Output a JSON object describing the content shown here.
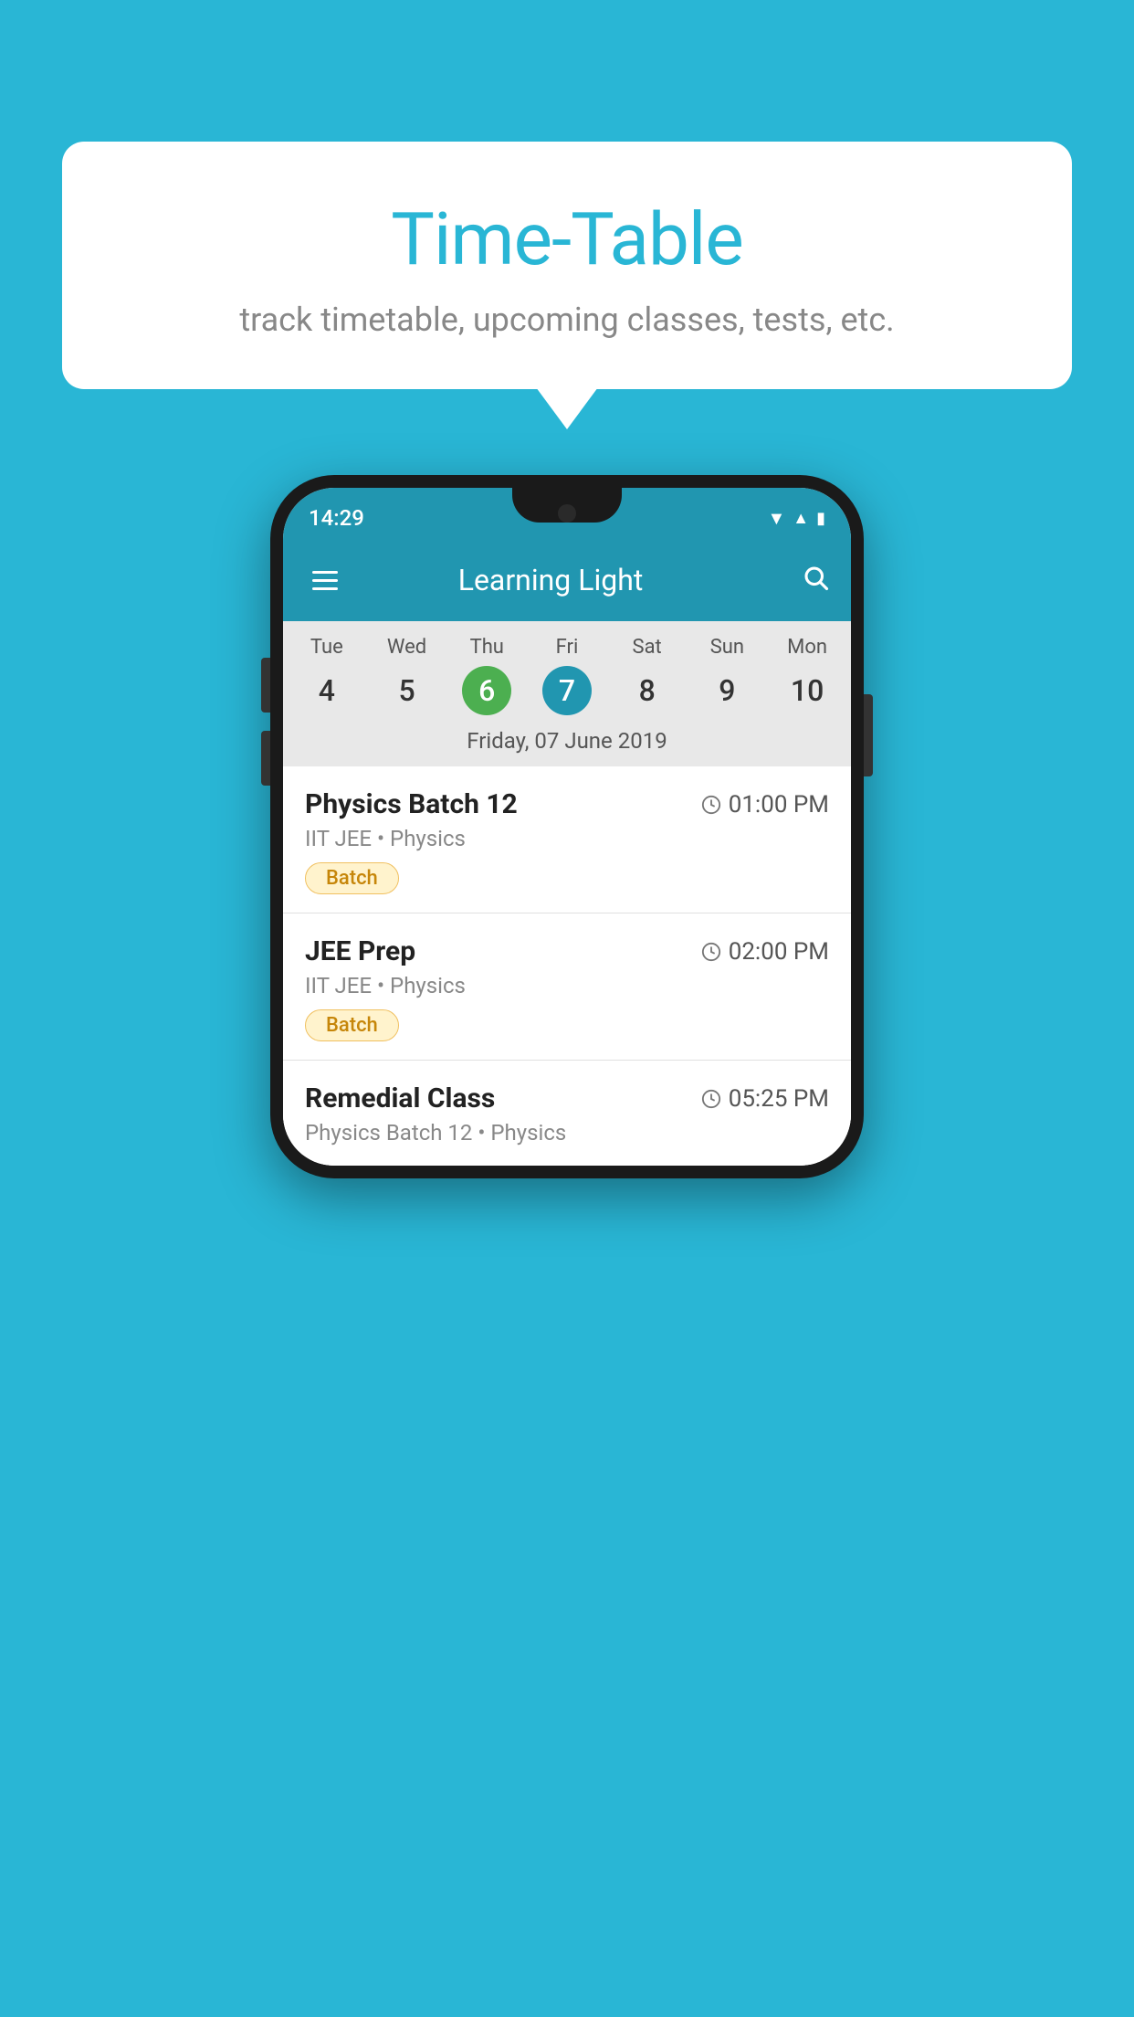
{
  "page": {
    "background_color": "#29B6D5"
  },
  "speech_bubble": {
    "title": "Time-Table",
    "subtitle": "track timetable, upcoming classes, tests, etc."
  },
  "phone": {
    "status_bar": {
      "time": "14:29"
    },
    "toolbar": {
      "app_name": "Learning Light",
      "menu_icon": "hamburger-icon",
      "search_icon": "search-icon"
    },
    "calendar": {
      "selected_date_label": "Friday, 07 June 2019",
      "days": [
        {
          "name": "Tue",
          "number": "4",
          "state": "normal"
        },
        {
          "name": "Wed",
          "number": "5",
          "state": "normal"
        },
        {
          "name": "Thu",
          "number": "6",
          "state": "today"
        },
        {
          "name": "Fri",
          "number": "7",
          "state": "selected"
        },
        {
          "name": "Sat",
          "number": "8",
          "state": "normal"
        },
        {
          "name": "Sun",
          "number": "9",
          "state": "normal"
        },
        {
          "name": "Mon",
          "number": "10",
          "state": "normal"
        }
      ]
    },
    "schedule": {
      "items": [
        {
          "title": "Physics Batch 12",
          "time": "01:00 PM",
          "meta": "IIT JEE • Physics",
          "tag": "Batch"
        },
        {
          "title": "JEE Prep",
          "time": "02:00 PM",
          "meta": "IIT JEE • Physics",
          "tag": "Batch"
        },
        {
          "title": "Remedial Class",
          "time": "05:25 PM",
          "meta": "Physics Batch 12 • Physics",
          "tag": ""
        }
      ]
    }
  }
}
